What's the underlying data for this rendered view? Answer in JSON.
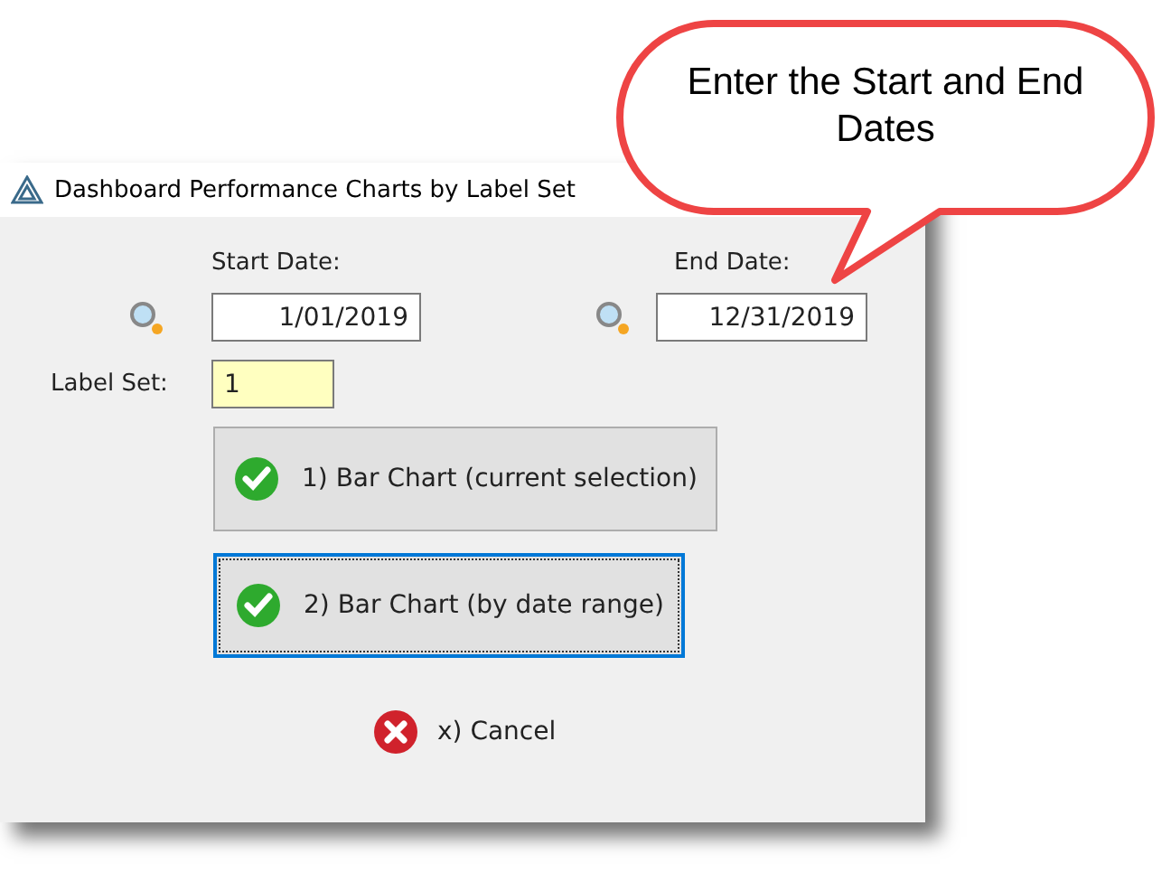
{
  "window": {
    "title": "Dashboard Performance Charts by Label Set"
  },
  "start_date": {
    "label": "Start Date:",
    "value": "1/01/2019"
  },
  "end_date": {
    "label": "End Date:",
    "value": "12/31/2019"
  },
  "label_set": {
    "label": "Label Set:",
    "value": "1"
  },
  "buttons": [
    {
      "label": "1) Bar Chart (current selection)",
      "kind": "ok",
      "focused": false
    },
    {
      "label": "2) Bar Chart (by date range)",
      "kind": "ok",
      "focused": true
    }
  ],
  "cancel": {
    "label": "x) Cancel",
    "kind": "cancel"
  },
  "callout": {
    "text": "Enter the Start and End Dates"
  }
}
